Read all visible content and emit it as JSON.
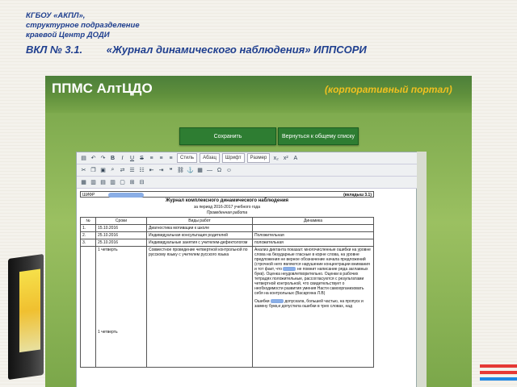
{
  "header": {
    "org_line1": "КГБОУ «АКПЛ»,",
    "org_line2": "структурное подразделение",
    "org_line3": "краевой Центр ДОДИ",
    "title_code": "ВКЛ № 3.1.",
    "title_text": "«Журнал динамического наблюдения» ИППСОРИ"
  },
  "portal": {
    "name": "ППМС АлтЦДО",
    "tagline": "(корпоративный портал)",
    "save_label": "Сохранить",
    "back_label": "Вернуться к общему списку"
  },
  "toolbar": {
    "style_select": "Стиль",
    "paragraph_select": "Абзац",
    "font_select": "Шрифт",
    "size_select": "Размер"
  },
  "document": {
    "school_label": "ШИФР",
    "annex_label": "(вкладыш 3.1)",
    "title": "Журнал комплексного динамического наблюдения",
    "period": "за период 2016-2017 учебного года",
    "subtitle": "Проведенная работа",
    "columns": [
      "№",
      "Сроки",
      "Виды работ",
      "Динамика"
    ],
    "rows": [
      {
        "n": "1.",
        "date": "15.10.2016",
        "work": "Диагностика мотивации к школе",
        "dyn": ""
      },
      {
        "n": "2.",
        "date": "25.10.2016",
        "work": "Индивидуальная консультация родителей",
        "dyn": "Положительная"
      },
      {
        "n": "3.",
        "date": "25.10.2016",
        "work": "Индивидуальные занятия с учителем-дефектологом",
        "dyn": "положительная"
      }
    ],
    "quarter1_label": "1 четверть",
    "quarter1_work": "Совместное проведение четвертной контрольной по русскому языку с учителем русского языка",
    "quarter1_dyn_a": "Анализ диктанта показал: многочисленные ошибки  на уровне слова на безударные гласные в корне слова, на уровне предложения не верное обозначение начала предложений (строчной него являются нарушение концентрации внимания и тот факт, что",
    "quarter1_dyn_b": "не помнит написание ряда заглавных букв). Оценка неудовлетворительно. Оценки в рабочих тетрадях положительные, рассогласуются с результатами четвертной контрольной, что свидетельствует о необходимости развития умения Насти самоорганизовать себя на контрольных (Васаргина Л.В)",
    "quarter2_label": "1 четверть",
    "quarter2_dyn_a": "Ошибки",
    "quarter2_dyn_b": "допускала, большей частью, на пропуск и замену букв,и допустила ошибки в трех словах, над"
  },
  "colors": {
    "title_blue": "#1f3f8f",
    "portal_green": "#4c7f3a",
    "button_green": "#2e7d32",
    "tagline_yellow": "#f0c020"
  }
}
